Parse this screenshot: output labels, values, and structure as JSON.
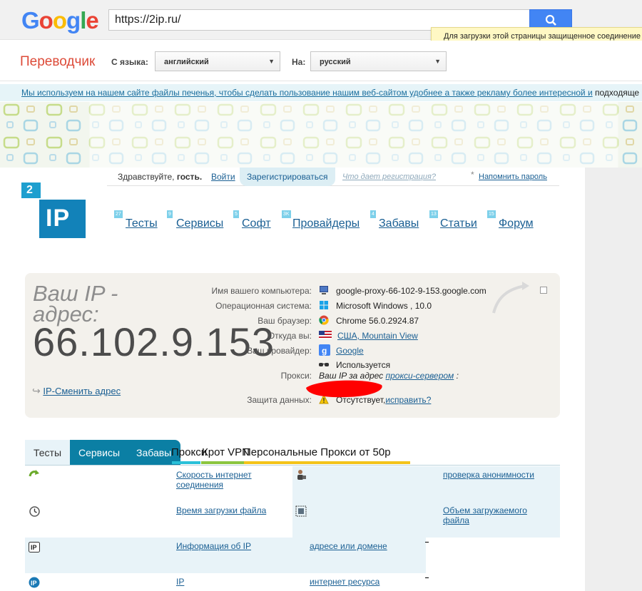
{
  "browser": {
    "logo": [
      "G",
      "o",
      "o",
      "g",
      "l",
      "e"
    ],
    "url": "https://2ip.ru/",
    "notice": "Для загрузки этой страницы защищенное соединение н"
  },
  "translator": {
    "title": "Переводчик",
    "from_label": "С языка:",
    "from_value": "английский",
    "to_label": "На:",
    "to_value": "русский"
  },
  "cookie": {
    "link_text": "Мы используем на нашем сайте файлы печенья, чтобы сделать пользование нашим веб-сайтом удобнее а также рекламу более интересной и",
    "tail": " подходяще"
  },
  "login": {
    "hello_prefix": "Здравствуйте,",
    "hello_user": "гость.",
    "login_link": "Войти",
    "register": "Зарегистрироваться",
    "what_gives": "Что дает регистрация?",
    "star": "*",
    "remind": "Напомнить пароль"
  },
  "logo": {
    "top": "2",
    "main": "IP"
  },
  "nav": [
    {
      "label": "Тесты",
      "count": "27"
    },
    {
      "label": "Сервисы",
      "count": "9"
    },
    {
      "label": "Софт",
      "count": "5"
    },
    {
      "label": "Провайдеры",
      "count": "3K"
    },
    {
      "label": "Забавы",
      "count": "4"
    },
    {
      "label": "Статьи",
      "count": "13"
    },
    {
      "label": "Форум",
      "count": "15"
    }
  ],
  "info": {
    "heading_line1": "Ваш IP -",
    "heading_line2": "адрес:",
    "ip": "66.102.9.153",
    "change_ip": "IP-Сменить адрес",
    "rows": [
      {
        "label": "Имя вашего компьютера:",
        "value": "google-proxy-66-102-9-153.google.com",
        "link": false
      },
      {
        "label": "Операционная система:",
        "value": "Microsoft Windows , 10.0",
        "link": false
      },
      {
        "label": "Ваш браузер:",
        "value": "Chrome 56.0.2924.87",
        "link": false
      },
      {
        "label": "Откуда вы:",
        "value": "США, Mountain View",
        "link": true
      },
      {
        "label": "Ваш провайдер:",
        "value": "Google",
        "link": true
      },
      {
        "label": "",
        "value": "Используется",
        "link": false
      }
    ],
    "proxy_label": "Прокси:",
    "proxy_text": "Ваш IP за адрес",
    "proxy_link": "прокси-сервером",
    "proxy_tail": ":",
    "protect_label": "Защита данных:",
    "protect_value": "Отсутствует,",
    "protect_fix": "исправить?"
  },
  "tabs": {
    "t1": "Тесты",
    "t2": "Сервисы",
    "t3": "Забавы",
    "overlay1": "Прокси",
    "overlay2": "Крот VPN",
    "overlay3": "Персональные Прокси от 50р"
  },
  "list": [
    {
      "col1": "Скорость интернет соединения",
      "col2": "проверка анонимности"
    },
    {
      "col1": "Время загрузки файла",
      "col2": "Объем загружаемого файла"
    },
    {
      "col1": "Информация об IP",
      "col2": "адресе или домене"
    },
    {
      "col1": "IP",
      "col2": "интернет ресурса"
    }
  ],
  "colors": {
    "accent": "#1282b9",
    "tab_active": "#0b7fa4",
    "link": "#1a5f93"
  }
}
